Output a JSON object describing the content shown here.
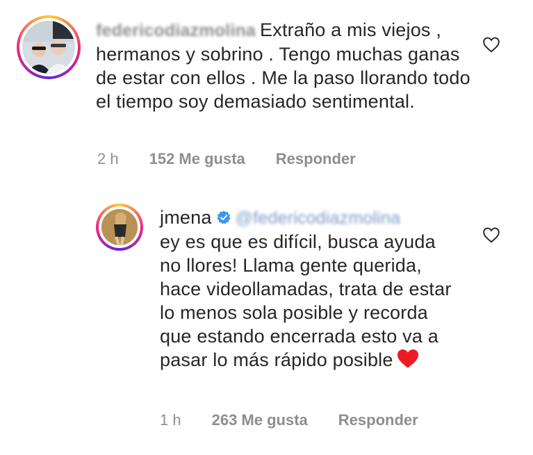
{
  "comments": [
    {
      "username": "federicodiazmolina",
      "text": "Extraño  a mis viejos , hermanos y sobrino . Tengo muchas ganas de estar con ellos . Me la paso llorando todo el tiempo soy demasiado sentimental.",
      "time": "2 h",
      "likes": "152 Me gusta",
      "reply_label": "Responder"
    },
    {
      "username": "jmena",
      "mention": "@federicodiazmolina",
      "text": "ey es que es difícil, busca ayuda no llores! Llama gente querida, hace videollamadas, trata de estar lo menos sola posible y recorda que estando encerrada esto va a pasar lo más rápido posible",
      "time": "1 h",
      "likes": "263 Me gusta",
      "reply_label": "Responder"
    }
  ],
  "icons": {
    "like": "heart-outline-icon",
    "verified": "verified-badge-icon",
    "emoji": "red-heart-emoji"
  },
  "colors": {
    "muted_text": "#8e8e8e",
    "verified_blue": "#3897f0",
    "heart_red": "#ed1c24"
  }
}
